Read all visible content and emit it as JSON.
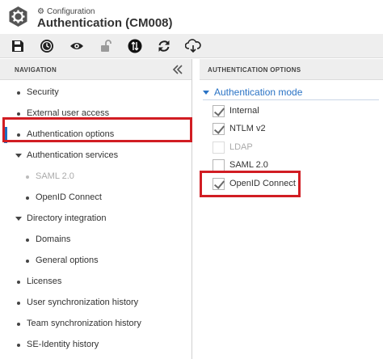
{
  "header": {
    "breadcrumb": "Configuration",
    "title": "Authentication (CM008)",
    "logo_icon": "hexagon-gear-logo"
  },
  "toolbar": {
    "buttons": [
      {
        "name": "save",
        "icon": "floppy-disk-icon"
      },
      {
        "name": "history",
        "icon": "history-clock-icon"
      },
      {
        "name": "view",
        "icon": "eye-icon"
      },
      {
        "name": "lock",
        "icon": "unlock-icon",
        "disabled": true
      },
      {
        "name": "sync",
        "icon": "sync-arrow-icon"
      },
      {
        "name": "refresh",
        "icon": "refresh-icon"
      },
      {
        "name": "cloud",
        "icon": "cloud-download-icon"
      }
    ]
  },
  "navigation": {
    "title": "NAVIGATION",
    "collapse_icon": "double-chevron-left-icon",
    "items": [
      {
        "label": "Security",
        "level": 0,
        "type": "bullet"
      },
      {
        "label": "External user access",
        "level": 0,
        "type": "bullet"
      },
      {
        "label": "Authentication options",
        "level": 0,
        "type": "bullet",
        "active": true
      },
      {
        "label": "Authentication services",
        "level": 0,
        "type": "expand"
      },
      {
        "label": "SAML 2.0",
        "level": 1,
        "type": "bullet",
        "disabled": true
      },
      {
        "label": "OpenID Connect",
        "level": 1,
        "type": "bullet"
      },
      {
        "label": "Directory integration",
        "level": 0,
        "type": "expand"
      },
      {
        "label": "Domains",
        "level": 1,
        "type": "bullet"
      },
      {
        "label": "General options",
        "level": 1,
        "type": "bullet"
      },
      {
        "label": "Licenses",
        "level": 0,
        "type": "bullet"
      },
      {
        "label": "User synchronization history",
        "level": 0,
        "type": "bullet"
      },
      {
        "label": "Team synchronization history",
        "level": 0,
        "type": "bullet"
      },
      {
        "label": "SE-Identity history",
        "level": 0,
        "type": "bullet"
      }
    ]
  },
  "auth": {
    "title": "AUTHENTICATION OPTIONS",
    "section_title": "Authentication mode",
    "options": [
      {
        "label": "Internal",
        "checked": true,
        "disabled": false
      },
      {
        "label": "NTLM v2",
        "checked": true,
        "disabled": false
      },
      {
        "label": "LDAP",
        "checked": false,
        "disabled": true
      },
      {
        "label": "SAML 2.0",
        "checked": false,
        "disabled": false
      },
      {
        "label": "OpenID Connect",
        "checked": true,
        "disabled": false
      }
    ]
  },
  "colors": {
    "accent": "#2a73c5",
    "highlight": "#d11d23",
    "active_bar": "#1d6fc1"
  }
}
